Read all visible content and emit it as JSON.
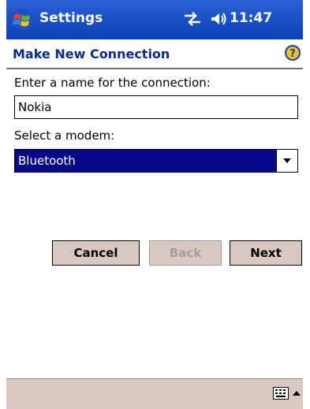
{
  "titlebar": {
    "app_title": "Settings",
    "time": "11:47",
    "start_icon": "windows-flag-icon",
    "connectivity_icon": "connectivity-arrows-icon",
    "volume_icon": "speaker-icon"
  },
  "header": {
    "title": "Make New Connection",
    "help_icon": "help-icon"
  },
  "form": {
    "name_label": "Enter a name for the connection:",
    "name_value": "Nokia",
    "modem_label": "Select a modem:",
    "modem_value": "Bluetooth"
  },
  "buttons": {
    "cancel": "Cancel",
    "back": "Back",
    "next": "Next"
  },
  "bottombar": {
    "keyboard_icon": "keyboard-icon",
    "sip_arrow_icon": "up-arrow-icon"
  },
  "colors": {
    "titlebar": "#0a3fb8",
    "header_text": "#0a2a8c",
    "selection": "#08088a",
    "button_face": "#d8c8c0"
  }
}
